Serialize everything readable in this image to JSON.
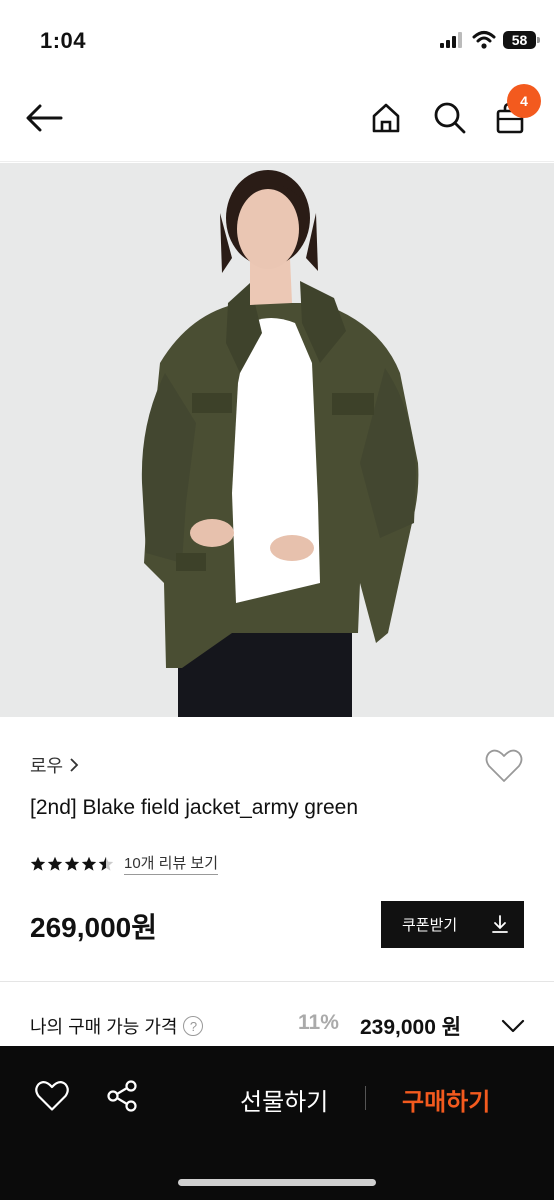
{
  "status": {
    "time": "1:04",
    "battery": "58"
  },
  "nav": {
    "cart_count": "4"
  },
  "product": {
    "brand": "로우",
    "title": "[2nd] Blake field jacket_army green",
    "rating_stars": 4.5,
    "review_link": "10개 리뷰 보기",
    "price": "269,000원",
    "coupon_label": "쿠폰받기"
  },
  "my_price": {
    "label": "나의 구매 가능 가격",
    "help": "?",
    "discount": "11%",
    "price": "239,000 원"
  },
  "bottom_bar": {
    "gift_label": "선물하기",
    "buy_label": "구매하기"
  },
  "colors": {
    "accent": "#f35a1e",
    "bar_bg": "#0b0b0b"
  },
  "icons": [
    "back-arrow-icon",
    "home-icon",
    "search-icon",
    "shopping-bag-icon",
    "heart-icon",
    "share-icon",
    "chevron-down-icon",
    "download-icon",
    "star-icon"
  ]
}
